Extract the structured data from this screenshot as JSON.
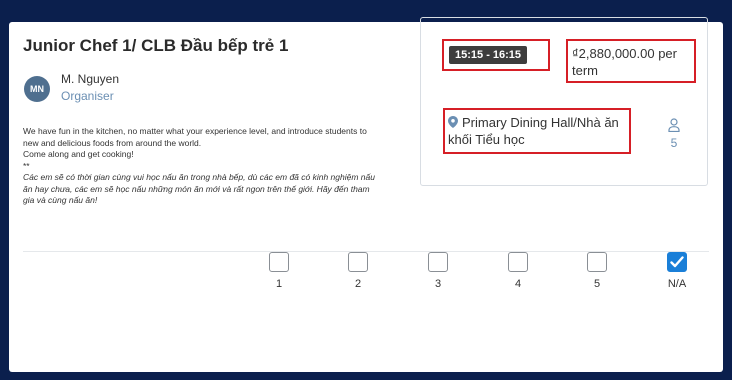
{
  "activity": {
    "title": "Junior Chef 1/ CLB Đầu bếp trẻ 1",
    "organiser": {
      "initials": "MN",
      "name": "M. Nguyen",
      "role": "Organiser"
    },
    "description_en_1": "We have fun in the kitchen, no matter what your experience level, and introduce students to new and delicious foods from around the world.",
    "description_en_2": "Come along and get cooking!",
    "separator": "**",
    "description_vi": "Các em sẽ có thời gian cùng vui học nấu ăn trong nhà bếp, dù các em đã có kinh nghiệm nấu ăn hay chưa, các em sẽ học nấu những món ăn mới và rất ngon trên thế giới. Hãy đến tham gia và cùng nấu ăn!"
  },
  "info": {
    "time": "15:15 - 16:15",
    "price": "₫2,880,000.00 per term",
    "location": "Primary Dining Hall/Nhà ăn khối Tiểu học",
    "capacity": "5"
  },
  "options": [
    {
      "label": "1",
      "checked": false
    },
    {
      "label": "2",
      "checked": false
    },
    {
      "label": "3",
      "checked": false
    },
    {
      "label": "4",
      "checked": false
    },
    {
      "label": "5",
      "checked": false
    },
    {
      "label": "N/A",
      "checked": true
    }
  ],
  "colors": {
    "background": "#0b1f4d",
    "highlight": "#d61f26",
    "accent": "#1a7fd8",
    "muted": "#6b8fb3"
  },
  "icons": {
    "location": "map-pin-icon",
    "capacity": "person-icon",
    "checked": "check-icon"
  }
}
